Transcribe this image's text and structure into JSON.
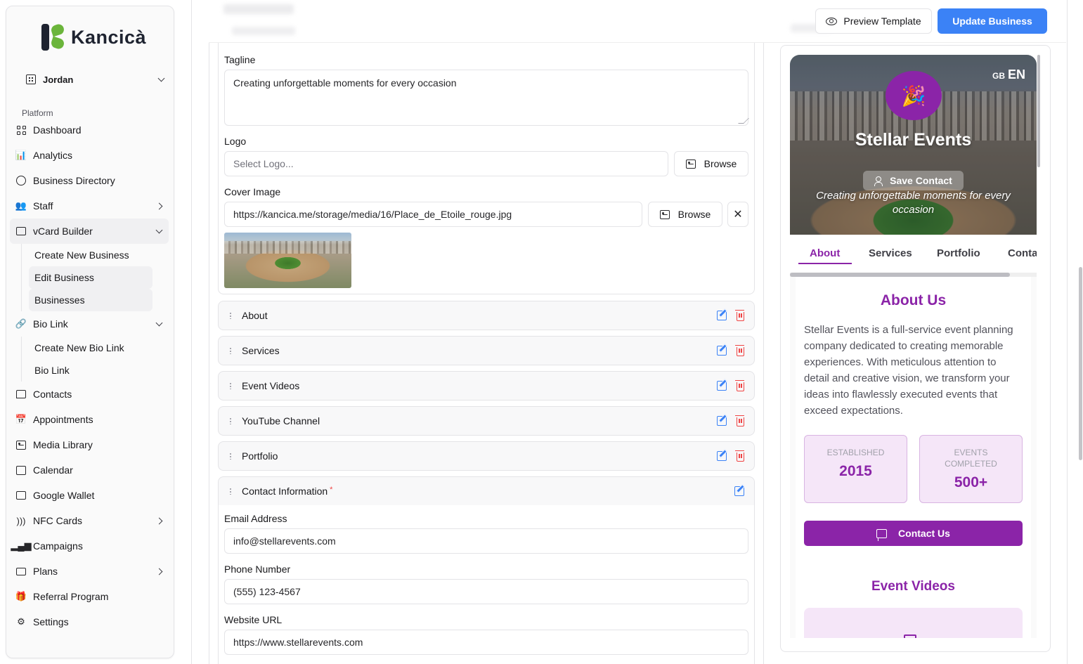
{
  "brand": {
    "name": "Kancicà"
  },
  "org": {
    "name": "Jordan"
  },
  "sidebar": {
    "group_label": "Platform",
    "items": [
      {
        "label": "Dashboard",
        "icon": "dashboard-grid-icon"
      },
      {
        "label": "Analytics",
        "icon": "bar-chart-icon"
      },
      {
        "label": "Business Directory",
        "icon": "globe-icon"
      },
      {
        "label": "Staff",
        "icon": "users-icon"
      },
      {
        "label": "vCard Builder",
        "icon": "mail-icon"
      },
      {
        "label": "Create New Business"
      },
      {
        "label": "Edit Business"
      },
      {
        "label": "Businesses"
      },
      {
        "label": "Bio Link",
        "icon": "link-icon"
      },
      {
        "label": "Create New Bio Link"
      },
      {
        "label": "Bio Link"
      },
      {
        "label": "Contacts",
        "icon": "message-icon"
      },
      {
        "label": "Appointments",
        "icon": "calendar-grid-icon"
      },
      {
        "label": "Media Library",
        "icon": "image-icon"
      },
      {
        "label": "Calendar",
        "icon": "calendar-icon"
      },
      {
        "label": "Google Wallet",
        "icon": "wallet-icon"
      },
      {
        "label": "NFC Cards",
        "icon": "nfc-icon"
      },
      {
        "label": "Campaigns",
        "icon": "signal-bars-icon"
      },
      {
        "label": "Plans",
        "icon": "credit-card-icon"
      },
      {
        "label": "Referral Program",
        "icon": "gift-icon"
      },
      {
        "label": "Settings",
        "icon": "gear-icon"
      }
    ]
  },
  "header": {
    "preview_label": "Preview Template",
    "update_label": "Update Business"
  },
  "form": {
    "tagline_label": "Tagline",
    "tagline_value": "Creating unforgettable moments for every occasion",
    "logo_label": "Logo",
    "logo_placeholder": "Select Logo...",
    "browse_label": "Browse",
    "cover_label": "Cover Image",
    "cover_value": "https://kancica.me/storage/media/16/Place_de_Etoile_rouge.jpg",
    "clear_symbol": "✕"
  },
  "sections": [
    {
      "title": "About"
    },
    {
      "title": "Services"
    },
    {
      "title": "Event Videos"
    },
    {
      "title": "YouTube Channel"
    },
    {
      "title": "Portfolio"
    },
    {
      "title": "Contact Information",
      "required_mark": "*"
    }
  ],
  "contact": {
    "email_label": "Email Address",
    "email_value": "info@stellarevents.com",
    "phone_label": "Phone Number",
    "phone_value": "(555) 123-4567",
    "website_label": "Website URL",
    "website_value": "https://www.stellarevents.com"
  },
  "preview": {
    "lang_flag": "GB",
    "lang_code": "EN",
    "business_name": "Stellar Events",
    "save_contact": "Save Contact",
    "tagline": "Creating unforgettable moments for every occasion",
    "tabs": [
      "About",
      "Services",
      "Portfolio",
      "Conta"
    ],
    "about_title": "About Us",
    "about_text": "Stellar Events is a full-service event planning company dedicated to creating memorable experiences. With meticulous attention to detail and creative vision, we transform your ideas into flawlessly executed events that exceed expectations.",
    "stats": [
      {
        "label": "ESTABLISHED",
        "value": "2015"
      },
      {
        "label": "EVENTS COMPLETED",
        "value": "500+"
      }
    ],
    "contact_button": "Contact Us",
    "videos_title": "Event Videos",
    "accent_color": "#8b24a8"
  },
  "colors": {
    "primary": "#3b82f6",
    "danger": "#ef4444",
    "brand_green": "#6bb53b"
  }
}
